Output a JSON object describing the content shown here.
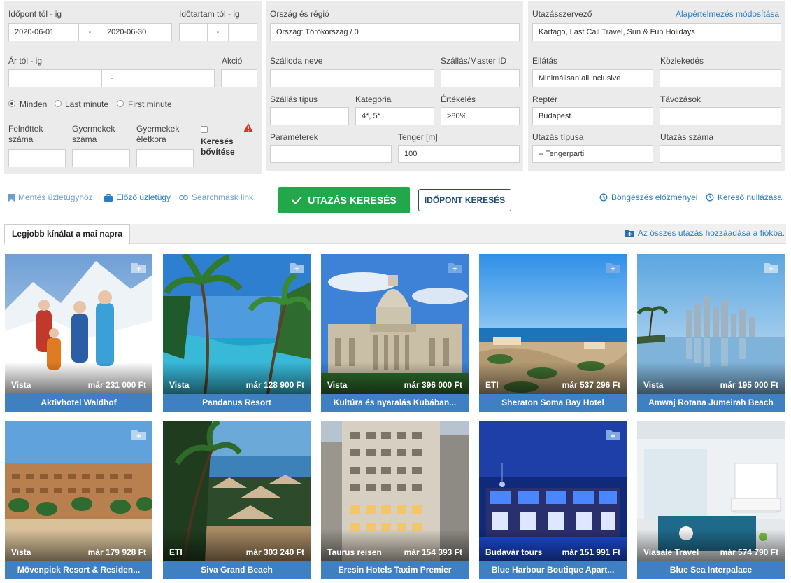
{
  "form": {
    "date_range": {
      "label": "Időpont tól - ig",
      "from": "2020-06-01",
      "to": "2020-06-30",
      "sep": "-"
    },
    "duration": {
      "label": "Időtartam tól - ig",
      "sep": "-"
    },
    "price": {
      "label": "Ár tól - ig",
      "sep": "-"
    },
    "action": {
      "label": "Akció"
    },
    "radios": [
      {
        "label": "Minden",
        "checked": true
      },
      {
        "label": "Last minute",
        "checked": false
      },
      {
        "label": "First minute",
        "checked": false
      }
    ],
    "adults": {
      "label_1": "Felnőttek",
      "label_2": "száma"
    },
    "children": {
      "label_1": "Gyermekek",
      "label_2": "száma"
    },
    "children_age": {
      "label_1": "Gyermekek",
      "label_2": "életkora"
    },
    "extend": {
      "label_1": "Keresés",
      "label_2": "bővítése"
    },
    "country": {
      "label": "Ország és régió",
      "value": "Ország: Törökország / 0"
    },
    "hotel_name": {
      "label": "Szálloda neve"
    },
    "master_id": {
      "label": "Szállás/Master ID"
    },
    "acc_type": {
      "label": "Szállás típus"
    },
    "category": {
      "label": "Kategória",
      "value": "4*, 5*"
    },
    "rating": {
      "label": "Értékelés",
      "value": ">80%"
    },
    "params": {
      "label": "Paraméterek"
    },
    "sea": {
      "label": "Tenger [m]",
      "value": "100"
    },
    "organizer": {
      "label": "Utazásszervező",
      "reset_link": "Alapértelmezés módosítása",
      "value": "Kartago, Last Call Travel, Sun & Fun Holidays"
    },
    "board": {
      "label": "Ellátás",
      "value": "Minimálisan all inclusive"
    },
    "transport": {
      "label": "Közlekedés"
    },
    "airport": {
      "label": "Reptér",
      "value": "Budapest"
    },
    "departures": {
      "label": "Távozások"
    },
    "trip_type": {
      "label": "Utazás típusa",
      "value": "-- Tengerparti"
    },
    "trip_number": {
      "label": "Utazás száma"
    }
  },
  "toolbar": {
    "save": "Mentés üzletügyhöz",
    "prev": "Előző üzletügy",
    "mask": "Searchmask link",
    "search": "UTAZÁS KERESÉS",
    "date_search": "IDŐPONT KERESÉS",
    "history": "Böngészés előzményei",
    "reset": "Kereső nullázása"
  },
  "tabs": {
    "active": "Legjobb kínálat a mai napra",
    "add_all": "Az összes utazás hozzáadása a fiókba."
  },
  "offers": [
    {
      "agency": "Vista",
      "price": "már 231 000 Ft",
      "name": "Aktivhotel Waldhof"
    },
    {
      "agency": "Vista",
      "price": "már 128 900 Ft",
      "name": "Pandanus Resort"
    },
    {
      "agency": "Vista",
      "price": "már 396 000 Ft",
      "name": "Kultúra és nyaralás Kubában..."
    },
    {
      "agency": "ETI",
      "price": "már 537 296 Ft",
      "name": "Sheraton Soma Bay Hotel"
    },
    {
      "agency": "Vista",
      "price": "már 195 000 Ft",
      "name": "Amwaj Rotana Jumeirah Beach"
    },
    {
      "agency": "Vista",
      "price": "már 179 928 Ft",
      "name": "Mövenpick Resort & Residen..."
    },
    {
      "agency": "ETI",
      "price": "már 303 240 Ft",
      "name": "Siva Grand Beach"
    },
    {
      "agency": "Taurus reisen",
      "price": "már 154 393 Ft",
      "name": "Eresin Hotels Taxim Premier"
    },
    {
      "agency": "Budavár tours",
      "price": "már 151 991 Ft",
      "name": "Blue Harbour Boutique Apart..."
    },
    {
      "agency": "Viasale Travel",
      "price": "már 574 790 Ft",
      "name": "Blue Sea Interpalace"
    }
  ],
  "colors": {
    "accent": "#3f80c3",
    "search_green": "#22a74a",
    "panel": "#ebebeb"
  }
}
